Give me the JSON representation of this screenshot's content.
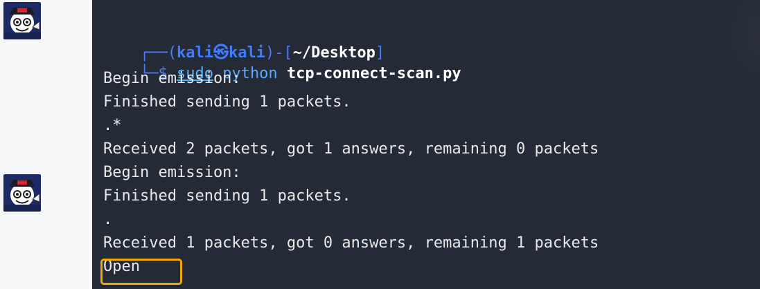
{
  "prompt": {
    "frame_open": "┌──(",
    "user_host": "kali㉿kali",
    "frame_mid": ")-[",
    "path": "~/Desktop",
    "frame_close": "]",
    "arrow": "└─$ ",
    "sudo": "sudo",
    "python": "python",
    "script": "tcp-connect-scan.py"
  },
  "output_lines": [
    "Begin emission:",
    "Finished sending 1 packets.",
    ".*",
    "Received 2 packets, got 1 answers, remaining 0 packets",
    "Begin emission:",
    "Finished sending 1 packets.",
    ".",
    "Received 1 packets, got 0 answers, remaining 1 packets",
    "Open"
  ],
  "colors": {
    "terminal_bg": "#252a37",
    "highlight_border": "#f2a800",
    "prompt_accent": "#3f7cff"
  }
}
